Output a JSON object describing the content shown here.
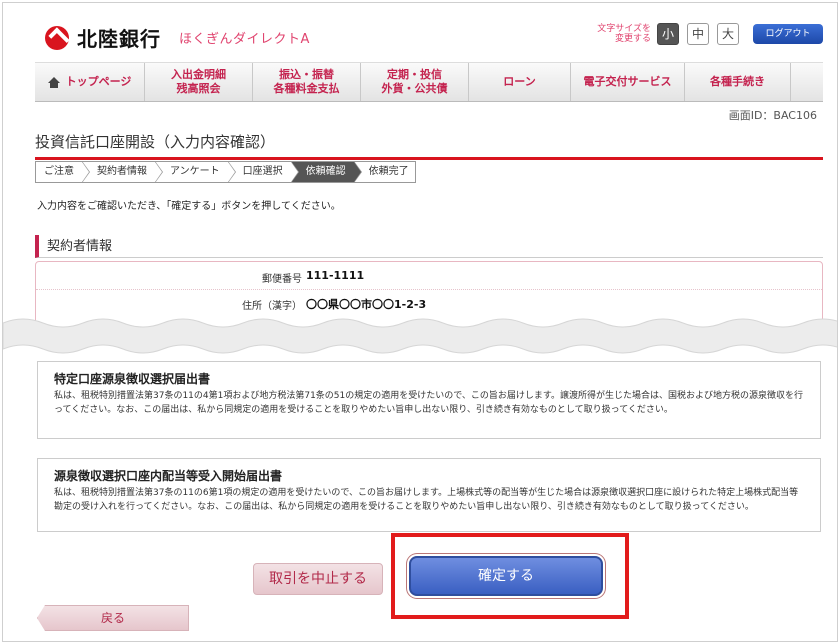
{
  "header": {
    "bank_name": "北陸銀行",
    "service_name": "ほくぎんダイレクトA",
    "font_size_label_line1": "文字サイズを",
    "font_size_label_line2": "変更する",
    "font_sizes": [
      "小",
      "中",
      "大"
    ],
    "logout_label": "ログアウト"
  },
  "nav": {
    "items": [
      {
        "line1": "トップページ",
        "line2": ""
      },
      {
        "line1": "入出金明細",
        "line2": "残高照会"
      },
      {
        "line1": "振込・振替",
        "line2": "各種料金支払"
      },
      {
        "line1": "定期・投信",
        "line2": "外貨・公共債"
      },
      {
        "line1": "ローン",
        "line2": ""
      },
      {
        "line1": "電子交付サービス",
        "line2": ""
      },
      {
        "line1": "各種手続き",
        "line2": ""
      }
    ]
  },
  "screen_id": "画面ID：BAC106",
  "page_title": "投資信託口座開設（入力内容確認）",
  "steps": [
    "ご注意",
    "契約者情報",
    "アンケート",
    "口座選択",
    "依頼確認",
    "依頼完了"
  ],
  "current_step": "依頼確認",
  "instruction": "入力内容をご確認いただき、「確定する」ボタンを押してください。",
  "section_title": "契約者情報",
  "contract_info": {
    "postal_label": "郵便番号",
    "postal_value": "111-1111",
    "address_label": "住所（漢字）",
    "address_value": "〇〇県〇〇市〇〇1-2-3"
  },
  "notices": [
    {
      "title": "特定口座源泉徴収選択届出書",
      "body": "私は、租税特別措置法第37条の11の4第1項および地方税法第71条の51の規定の適用を受けたいので、この旨お届けします。譲渡所得が生じた場合は、国税および地方税の源泉徴収を行ってください。なお、この届出は、私から同規定の適用を受けることを取りやめたい旨申し出ない限り、引き続き有効なものとして取り扱ってください。"
    },
    {
      "title": "源泉徴収選択口座内配当等受入開始届出書",
      "body": "私は、租税特別措置法第37条の11の6第1項の規定の適用を受けたいので、この旨お届けします。上場株式等の配当等が生じた場合は源泉徴収選択口座に設けられた特定上場株式配当等勘定の受け入れを行ってください。なお、この届出は、私から同規定の適用を受けることを取りやめたい旨申し出ない限り、引き続き有効なものとして取り扱ってください。"
    }
  ],
  "buttons": {
    "cancel": "取引を中止する",
    "confirm": "確定する",
    "back": "戻る"
  },
  "colors": {
    "accent_red": "#d9141e",
    "nav_text": "#c4234f",
    "confirm_blue": "#3a5fc2",
    "highlight_red": "#e21b1b"
  }
}
